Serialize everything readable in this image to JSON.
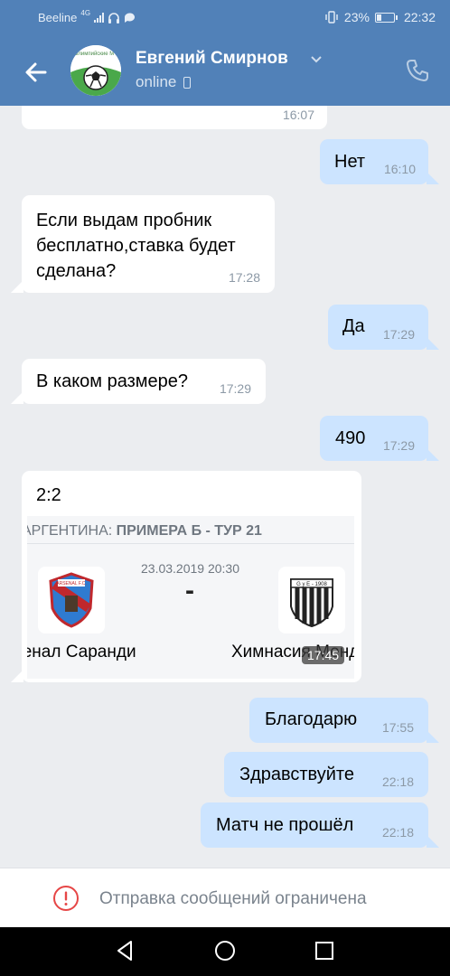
{
  "statusbar": {
    "carrier": "Beeline",
    "network": "4G",
    "battery": "23%",
    "battery_level": 0.23,
    "time": "22:32"
  },
  "header": {
    "name": "Евгений Смирнов",
    "status": "online",
    "avatar_text": "Олимпийские МЧ"
  },
  "messages": [
    {
      "dir": "in",
      "text": "",
      "time": "16:07"
    },
    {
      "dir": "out",
      "text": "Нет",
      "time": "16:10"
    },
    {
      "dir": "in",
      "lines": [
        "Если выдам пробник",
        "бесплатно,ставка будет",
        "сделана?"
      ],
      "time": "17:28"
    },
    {
      "dir": "out",
      "text": "Да",
      "time": "17:29"
    },
    {
      "dir": "in",
      "text": "В каком размере?",
      "time": "17:29"
    },
    {
      "dir": "out",
      "text": "490",
      "time": "17:29"
    },
    {
      "dir": "in",
      "text": "2:2",
      "time": "17:45"
    },
    {
      "dir": "out",
      "text": "Благодарю",
      "time": "17:55"
    },
    {
      "dir": "out",
      "text": "Здравствуйте",
      "time": "22:18"
    },
    {
      "dir": "out",
      "text": "Матч не прошёл",
      "time": "22:18"
    }
  ],
  "match_card": {
    "league_prefix": "АРГЕНТИНА: ",
    "league": "ПРИМЕРА Б - ТУР 21",
    "datetime": "23.03.2019 20:30",
    "score": "-",
    "home_team": "Арсенал Саранди",
    "away_team": "Химнасия Мендоса",
    "home_logo_text": "ARSENAL F.C.",
    "away_logo_text": "G y E - 1908"
  },
  "restriction": {
    "text": "Отправка сообщений ограничена"
  },
  "colors": {
    "header": "#5181b8",
    "outgoing": "#cce4ff",
    "incoming": "#ffffff",
    "background": "#ebedf0",
    "warning": "#e64646"
  }
}
